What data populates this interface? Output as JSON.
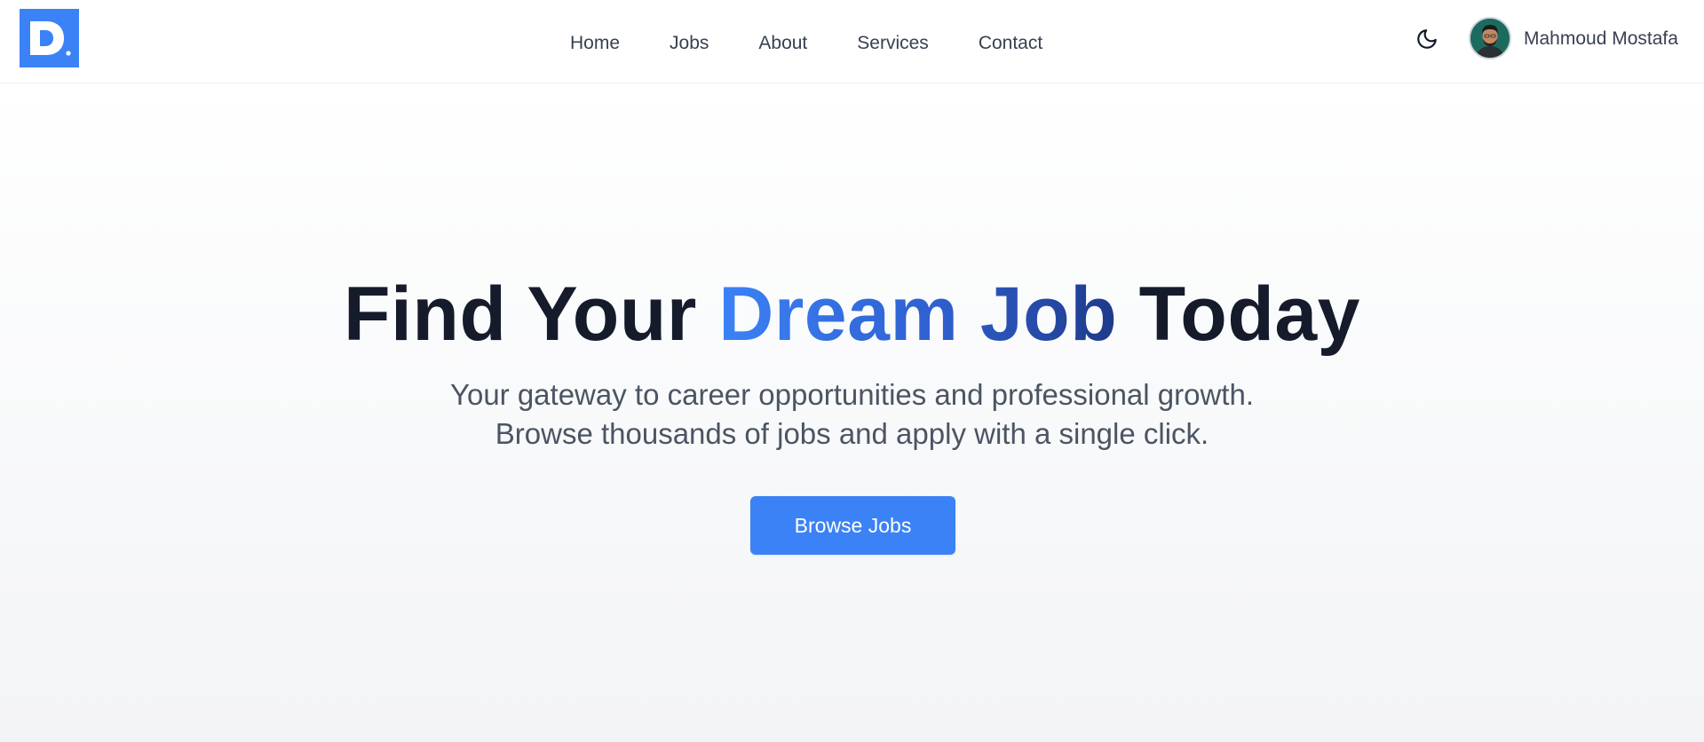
{
  "brand": {
    "logo_letter": "D",
    "logo_icon": "brand-logo-icon",
    "accent_color": "#3b82f6"
  },
  "nav": {
    "items": [
      {
        "label": "Home"
      },
      {
        "label": "Jobs"
      },
      {
        "label": "About"
      },
      {
        "label": "Services"
      },
      {
        "label": "Contact"
      }
    ]
  },
  "header": {
    "theme_toggle_icon": "moon-icon",
    "user": {
      "name": "Mahmoud Mostafa",
      "avatar_icon": "avatar"
    }
  },
  "hero": {
    "title_prefix": "Find Your",
    "title_accent": "Dream Job",
    "title_suffix": "Today",
    "subtitle_line1": "Your gateway to career opportunities and professional growth.",
    "subtitle_line2": "Browse thousands of jobs and apply with a single click.",
    "cta_label": "Browse Jobs",
    "title_color": "#151b2b",
    "accent_gradient": [
      "#3b82f6",
      "#1e3a8a"
    ]
  }
}
